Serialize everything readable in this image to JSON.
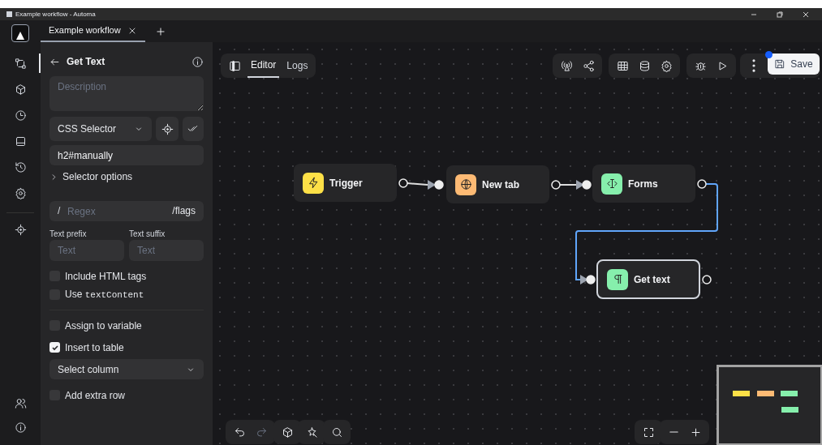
{
  "window": {
    "title": "Example workflow - Automa"
  },
  "tabs": [
    {
      "label": "Example workflow",
      "selected": true
    }
  ],
  "panel": {
    "title": "Get Text",
    "description": {
      "placeholder": "Description"
    },
    "selector_type": "CSS Selector",
    "selector": {
      "value": "h2#manually"
    },
    "selector_options": {
      "label": "Selector options",
      "expanded": false
    },
    "regex": {
      "prefix": "/",
      "placeholder": "Regex",
      "suffix": "/flags"
    },
    "text_prefix": {
      "label": "Text prefix",
      "placeholder": "Text"
    },
    "text_suffix": {
      "label": "Text suffix",
      "placeholder": "Text"
    },
    "options_a": [
      {
        "label": "Include HTML tags",
        "checked": false
      },
      {
        "label": "Use",
        "code": "textContent",
        "checked": false
      }
    ],
    "options_b": [
      {
        "label": "Assign to variable",
        "checked": false
      },
      {
        "label": "Insert to table",
        "checked": true
      }
    ],
    "column_select": "Select column",
    "options_c": [
      {
        "label": "Add extra row",
        "checked": false
      }
    ]
  },
  "view_tabs": [
    {
      "label": "Editor",
      "selected": true
    },
    {
      "label": "Logs",
      "selected": false
    }
  ],
  "save": {
    "label": "Save",
    "unsaved": true
  },
  "nodes": [
    {
      "label": "Trigger",
      "color": "#fde047",
      "selected": false
    },
    {
      "label": "New tab",
      "color": "#fdba74",
      "selected": false
    },
    {
      "label": "Forms",
      "color": "#86efac",
      "selected": false
    },
    {
      "label": "Get text",
      "color": "#86efac",
      "selected": true
    }
  ]
}
